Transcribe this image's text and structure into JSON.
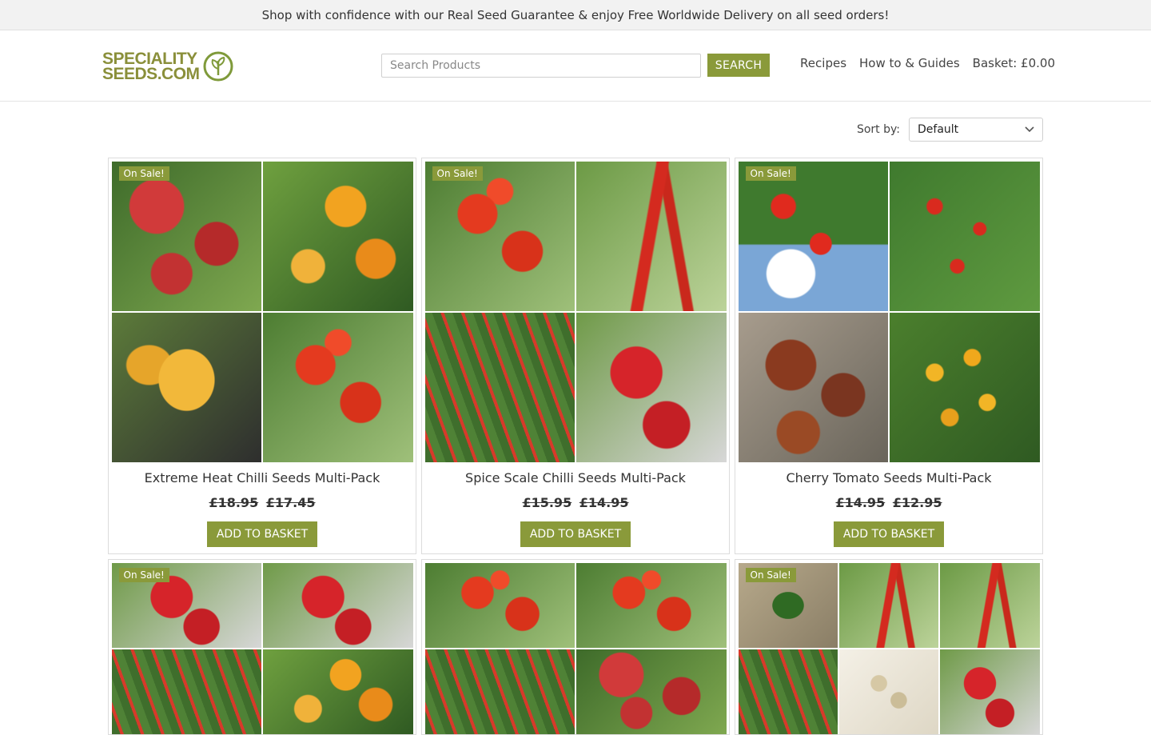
{
  "promo": {
    "text": "Shop with confidence with our Real Seed Guarantee & enjoy Free Worldwide Delivery on all seed orders!"
  },
  "logo": {
    "line1": "SPECIALITY",
    "line2": "SEEDS.COM"
  },
  "search": {
    "placeholder": "Search Products",
    "button": "SEARCH"
  },
  "nav": {
    "recipes": "Recipes",
    "guides": "How to & Guides",
    "basket": "Basket: £0.00"
  },
  "sort": {
    "label": "Sort by:",
    "selected": "Default"
  },
  "products": [
    {
      "badge": "On Sale!",
      "title": "Extreme Heat Chilli Seeds Multi-Pack",
      "old_price": "£18.95",
      "new_price": "£17.45",
      "button": "ADD TO BASKET"
    },
    {
      "badge": "On Sale!",
      "title": "Spice Scale Chilli Seeds Multi-Pack",
      "old_price": "£15.95",
      "new_price": "£14.95",
      "button": "ADD TO BASKET"
    },
    {
      "badge": "On Sale!",
      "title": "Cherry Tomato Seeds Multi-Pack",
      "old_price": "£14.95",
      "new_price": "£12.95",
      "button": "ADD TO BASKET"
    },
    {
      "badge": "On Sale!"
    },
    {
      "badge": ""
    },
    {
      "badge": "On Sale!"
    }
  ],
  "colors": {
    "accent": "#8a9a3a",
    "logo": "#8a8f3a"
  }
}
